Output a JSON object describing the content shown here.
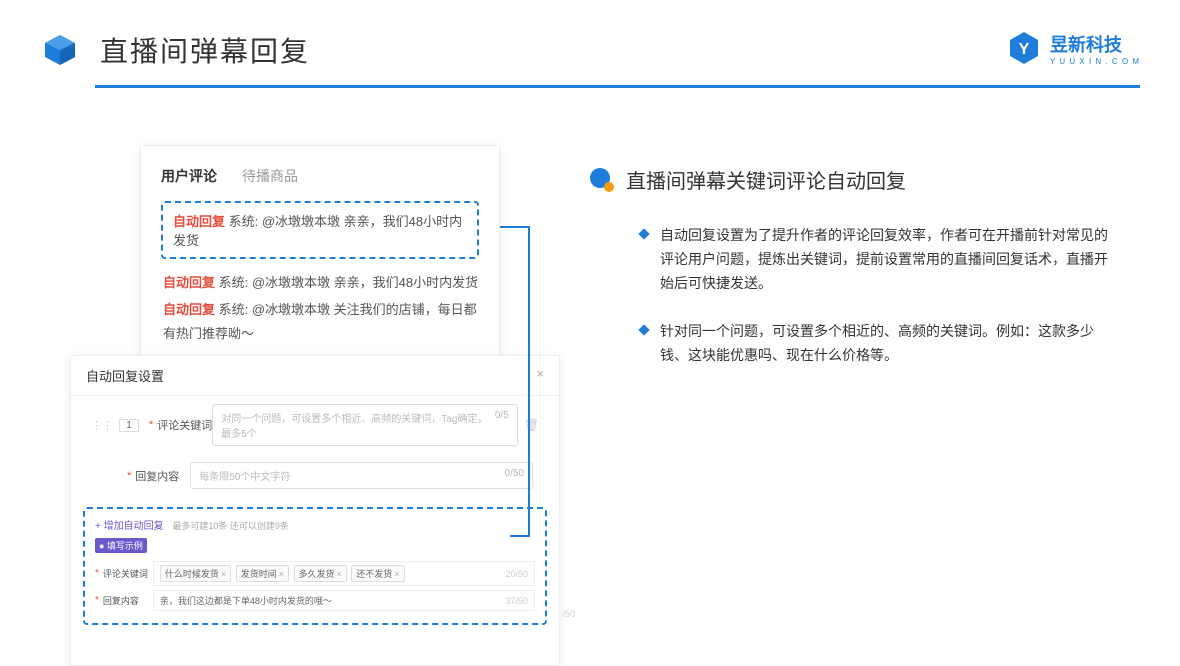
{
  "header": {
    "title": "直播间弹幕回复",
    "brand": "昱新科技",
    "brand_sub": "Y U U X I N . C O M"
  },
  "card1": {
    "tab1": "用户评论",
    "tab2": "待播商品",
    "highlight_tag": "自动回复",
    "highlight_text": "系统: @冰墩墩本墩 亲亲，我们48小时内发货",
    "line2_tag": "自动回复",
    "line2_text": "系统: @冰墩墩本墩 亲亲，我们48小时内发货",
    "line3_tag": "自动回复",
    "line3_text": "系统: @冰墩墩本墩 关注我们的店铺，每日都有热门推荐呦～"
  },
  "card2": {
    "title": "自动回复设置",
    "close": "×",
    "num": "1",
    "label1": "评论关键词",
    "placeholder1": "对同一个问题，可设置多个相近、高频的关键词，Tag确定，最多5个",
    "count1": "0/5",
    "label2": "回复内容",
    "placeholder2": "每条限50个中文字符",
    "count2": "0/50",
    "add_link": "+ 增加自动回复",
    "hint": "最多可建10条 还可以创建9条",
    "badge": "● 填写示例",
    "ex_label1": "评论关键词",
    "chip1": "什么时候发货",
    "chip2": "发货时间",
    "chip3": "多久发货",
    "chip4": "还不发货",
    "ex_count1": "20/50",
    "ex_label2": "回复内容",
    "ex_text2": "亲，我们这边都是下单48小时内发货的哦～",
    "ex_count2": "37/50",
    "footer_count": "/50"
  },
  "right": {
    "title": "直播间弹幕关键词评论自动回复",
    "p1": "自动回复设置为了提升作者的评论回复效率，作者可在开播前针对常见的评论用户问题，提炼出关键词，提前设置常用的直播间回复话术，直播开始后可快捷发送。",
    "p2": "针对同一个问题，可设置多个相近的、高频的关键词。例如：这款多少钱、这块能优惠吗、现在什么价格等。"
  }
}
